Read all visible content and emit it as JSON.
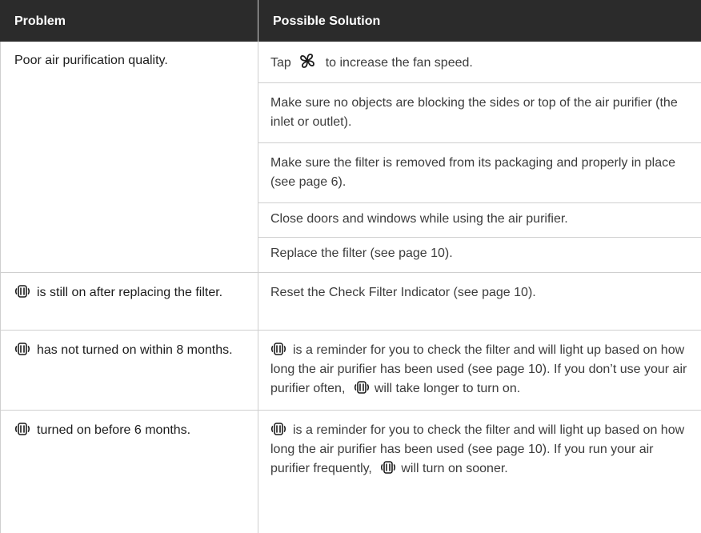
{
  "table": {
    "headers": {
      "problem": "Problem",
      "solution": "Possible Solution"
    },
    "rows": [
      {
        "problem": "Poor air purification quality.",
        "solutions": [
          {
            "before": "Tap",
            "icon": "fan-icon",
            "after": "to increase the fan speed."
          },
          {
            "text": "Make sure no objects are blocking the sides or top of the air purifier (the inlet or outlet)."
          },
          {
            "text": "Make sure the filter is removed from its packaging and properly in place (see page 6)."
          },
          {
            "text": "Close doors and windows while using the air purifier."
          },
          {
            "text": "Replace the filter (see page 10)."
          }
        ]
      },
      {
        "problem_icon": "check-filter-icon",
        "problem": "is still on after replacing the filter.",
        "solutions": [
          {
            "text": "Reset the Check Filter Indicator (see page 10)."
          }
        ]
      },
      {
        "problem_icon": "check-filter-icon",
        "problem": "has not turned on within 8 months.",
        "solutions": [
          {
            "icon": "check-filter-icon",
            "part1": "is a reminder for you to check the filter and will light up based on how long the air purifier has been used (see page 10). If you don’t use your air purifier often,",
            "icon2": "check-filter-icon",
            "part2": "will take longer to turn on."
          }
        ]
      },
      {
        "problem_icon": "check-filter-icon",
        "problem": "turned on before 6 months.",
        "solutions": [
          {
            "icon": "check-filter-icon",
            "part1": "is a reminder for you to check the filter and will light up based on how long the air purifier has been used (see page 10). If you run your air purifier frequently,",
            "icon2": "check-filter-icon",
            "part2": "will turn on sooner."
          }
        ]
      }
    ]
  }
}
